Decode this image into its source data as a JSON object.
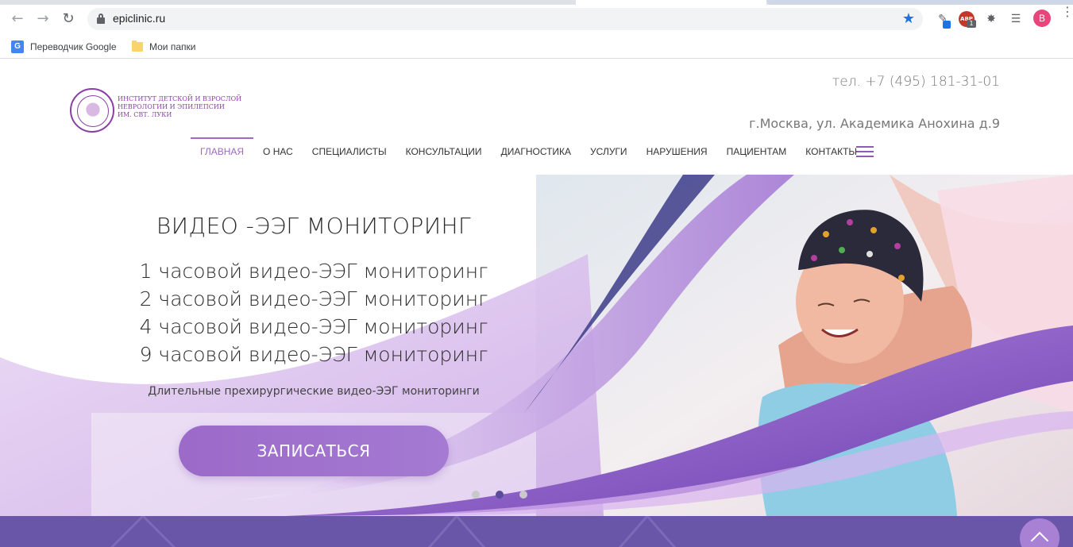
{
  "browser": {
    "url": "epiclinic.ru",
    "avatar_letter": "B",
    "abp_label": "ABP",
    "abp_badge": "1",
    "bookmarks": [
      {
        "label": "Переводчик Google",
        "icon": "google-translate-icon"
      },
      {
        "label": "Мои папки",
        "icon": "folder-icon"
      }
    ]
  },
  "header": {
    "logo_lines": [
      "ИНСТИТУТ ДЕТСКОЙ И ВЗРОСЛОЙ",
      "НЕВРОЛОГИИ И ЭПИЛЕПСИИ",
      "ИМ. СВТ. ЛУКИ"
    ],
    "phone": "тел. +7 (495) 181-31-01",
    "address": "г.Москва, ул. Академика Анохина д.9"
  },
  "nav": {
    "items": [
      "ГЛАВНАЯ",
      "О НАС",
      "СПЕЦИАЛИСТЫ",
      "КОНСУЛЬТАЦИИ",
      "ДИАГНОСТИКА",
      "УСЛУГИ",
      "НАРУШЕНИЯ",
      "ПАЦИЕНТАМ",
      "КОНТАКТЫ"
    ],
    "active_index": 0
  },
  "hero": {
    "title": "ВИДЕО -ЭЭГ МОНИТОРИНГ",
    "lines": [
      "1 часовой видео-ЭЭГ мониторинг",
      "2 часовой видео-ЭЭГ мониторинг",
      "4 часовой видео-ЭЭГ мониторинг",
      "9 часовой видео-ЭЭГ мониторинг"
    ],
    "subtitle": "Длительные прехирургические видео-ЭЭГ мониторинги",
    "cta_label": "ЗАПИСАТЬСЯ",
    "slide_count": 3,
    "active_slide": 1
  },
  "colors": {
    "accent": "#9b6bbf",
    "cta": "#a07ad0",
    "band": "#6a56a8",
    "dot_active": "#5c4a9a"
  }
}
